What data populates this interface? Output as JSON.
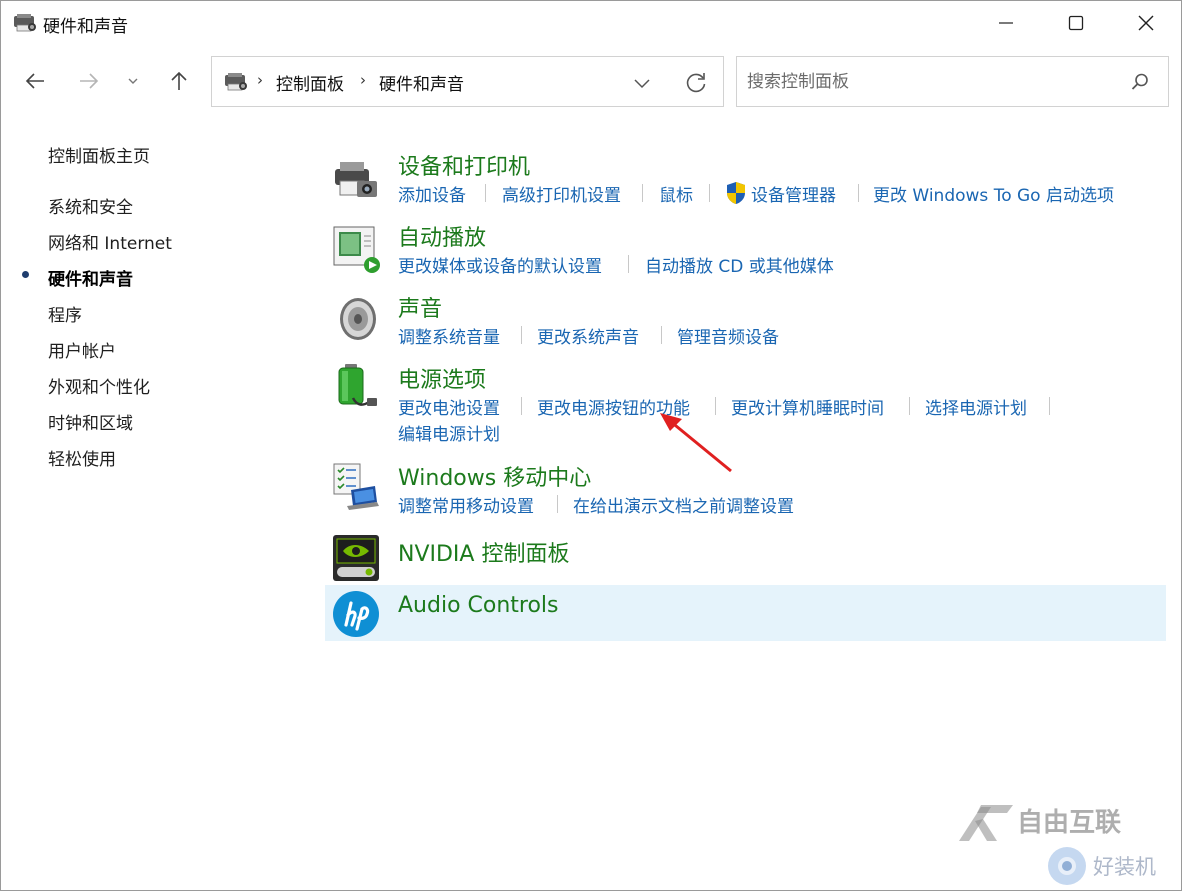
{
  "window": {
    "title": "硬件和声音",
    "minimize_label": "minimize",
    "maximize_label": "maximize",
    "close_label": "close"
  },
  "nav": {
    "breadcrumbs": [
      "控制面板",
      "硬件和声音"
    ]
  },
  "search": {
    "placeholder": "搜索控制面板"
  },
  "sidebar": {
    "items": [
      {
        "label": "控制面板主页",
        "active": false
      },
      {
        "label": "系统和安全",
        "active": false
      },
      {
        "label": "网络和 Internet",
        "active": false
      },
      {
        "label": "硬件和声音",
        "active": true
      },
      {
        "label": "程序",
        "active": false
      },
      {
        "label": "用户帐户",
        "active": false
      },
      {
        "label": "外观和个性化",
        "active": false
      },
      {
        "label": "时钟和区域",
        "active": false
      },
      {
        "label": "轻松使用",
        "active": false
      }
    ]
  },
  "categories": [
    {
      "title": "设备和打印机",
      "icon": "printer-camera-icon",
      "links": [
        "添加设备",
        "高级打印机设置",
        "鼠标",
        "设备管理器",
        "更改 Windows To Go 启动选项"
      ]
    },
    {
      "title": "自动播放",
      "icon": "autoplay-icon",
      "links": [
        "更改媒体或设备的默认设置",
        "自动播放 CD 或其他媒体"
      ]
    },
    {
      "title": "声音",
      "icon": "speaker-icon",
      "links": [
        "调整系统音量",
        "更改系统声音",
        "管理音频设备"
      ]
    },
    {
      "title": "电源选项",
      "icon": "battery-icon",
      "links": [
        "更改电池设置",
        "更改电源按钮的功能",
        "更改计算机睡眠时间",
        "选择电源计划",
        "编辑电源计划"
      ]
    },
    {
      "title": "Windows 移动中心",
      "icon": "mobility-center-icon",
      "links": [
        "调整常用移动设置",
        "在给出演示文档之前调整设置"
      ]
    },
    {
      "title": "NVIDIA 控制面板",
      "icon": "nvidia-icon",
      "links": []
    },
    {
      "title": "Audio Controls",
      "icon": "hp-icon",
      "links": []
    }
  ],
  "watermark": {
    "brand": "自由互联",
    "sub": "好装机"
  },
  "colors": {
    "category_title": "#1c7a1c",
    "link": "#1a66b2",
    "hover_bg": "#e5f3fb",
    "annotation_arrow": "#e02020"
  }
}
